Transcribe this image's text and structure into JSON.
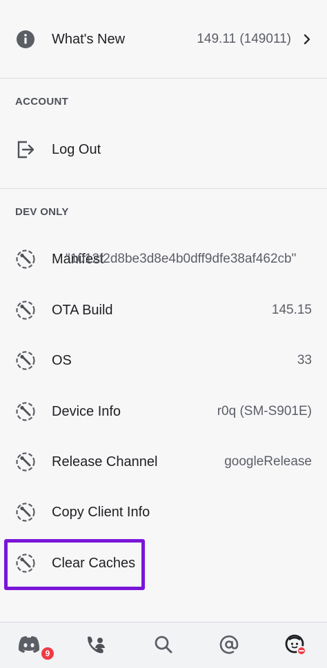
{
  "whats_new": {
    "label": "What's New",
    "value": "149.11 (149011)"
  },
  "account": {
    "header": "ACCOUNT",
    "items": [
      {
        "label": "Log Out"
      }
    ]
  },
  "dev_only": {
    "header": "DEV ONLY",
    "manifest": {
      "label": "Manifest",
      "value": "\"1012f2d8be3d8e4b0dff9dfe38af462cb\""
    },
    "items": [
      {
        "label": "OTA Build",
        "value": "145.15"
      },
      {
        "label": "OS",
        "value": "33"
      },
      {
        "label": "Device Info",
        "value": "r0q (SM-S901E)"
      },
      {
        "label": "Release Channel",
        "value": "googleRelease"
      },
      {
        "label": "Copy Client Info",
        "value": ""
      },
      {
        "label": "Clear Caches",
        "value": ""
      }
    ]
  },
  "tabbar": {
    "items": [
      {
        "icon": "discord-home-icon"
      },
      {
        "icon": "friends-icon"
      },
      {
        "icon": "search-icon"
      },
      {
        "icon": "mentions-icon"
      },
      {
        "icon": "profile-avatar-icon"
      }
    ],
    "home_badge": "9"
  },
  "colors": {
    "highlight": "#7a15d8",
    "badge": "#ef3b45"
  }
}
